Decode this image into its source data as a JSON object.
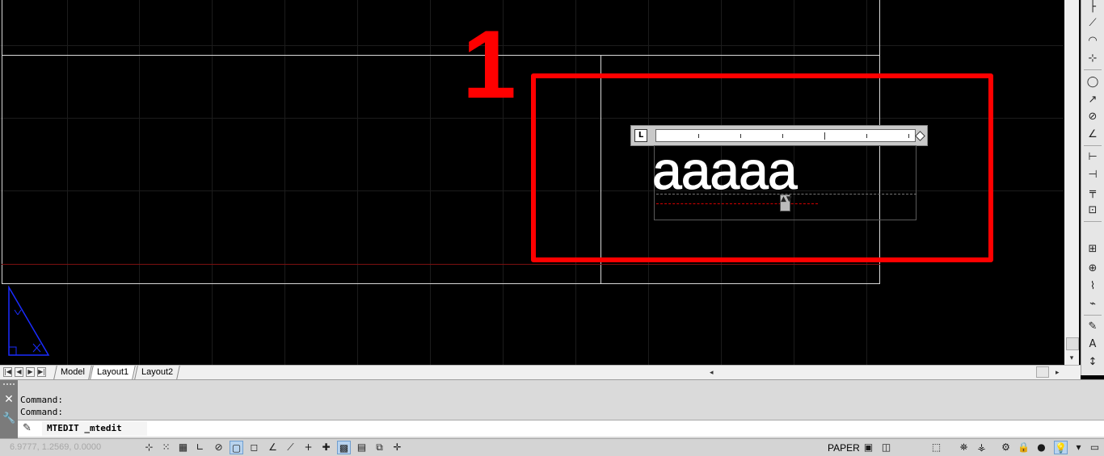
{
  "drawing": {
    "annotation_number": "1",
    "mtext_content": "aaaaa",
    "ruler_tab_symbol": "L",
    "resize_handle_symbol": "▲▼"
  },
  "colors": {
    "highlight": "#ff0000",
    "canvas_bg": "#000000",
    "ucs": "#1a2cff"
  },
  "tabs": {
    "nav_first": "|◀",
    "nav_prev": "◀",
    "nav_next": "▶",
    "nav_last": "▶|",
    "items": [
      {
        "label": "Model"
      },
      {
        "label": "Layout1"
      },
      {
        "label": "Layout2"
      }
    ]
  },
  "scrollbars": {
    "h_left_arrow": "◂",
    "h_right_arrow": "▸",
    "v_down_arrow": "▾"
  },
  "command": {
    "history": [
      "Command:",
      "Command:"
    ],
    "current": "MTEDIT _mtedit",
    "close_symbol": "✕",
    "customize_symbol": "🔧",
    "prompt_symbol": "✎"
  },
  "status_bar": {
    "coordinates": "6.9777, 1.2569, 0.0000",
    "space_label": "PAPER"
  },
  "right_toolbar": {
    "icons": [
      "line-icon",
      "angle-icon",
      "arc-icon",
      "coord-icon",
      "circle-icon",
      "arc3-icon",
      "no-icon",
      "angle2-icon",
      "dim-icon",
      "dim2-icon",
      "dim3-icon",
      "dim4-icon",
      "tolerance-icon",
      "center-icon",
      "break-icon",
      "jog-icon",
      "edit-icon",
      "text-icon",
      "vertical-text-icon"
    ]
  }
}
